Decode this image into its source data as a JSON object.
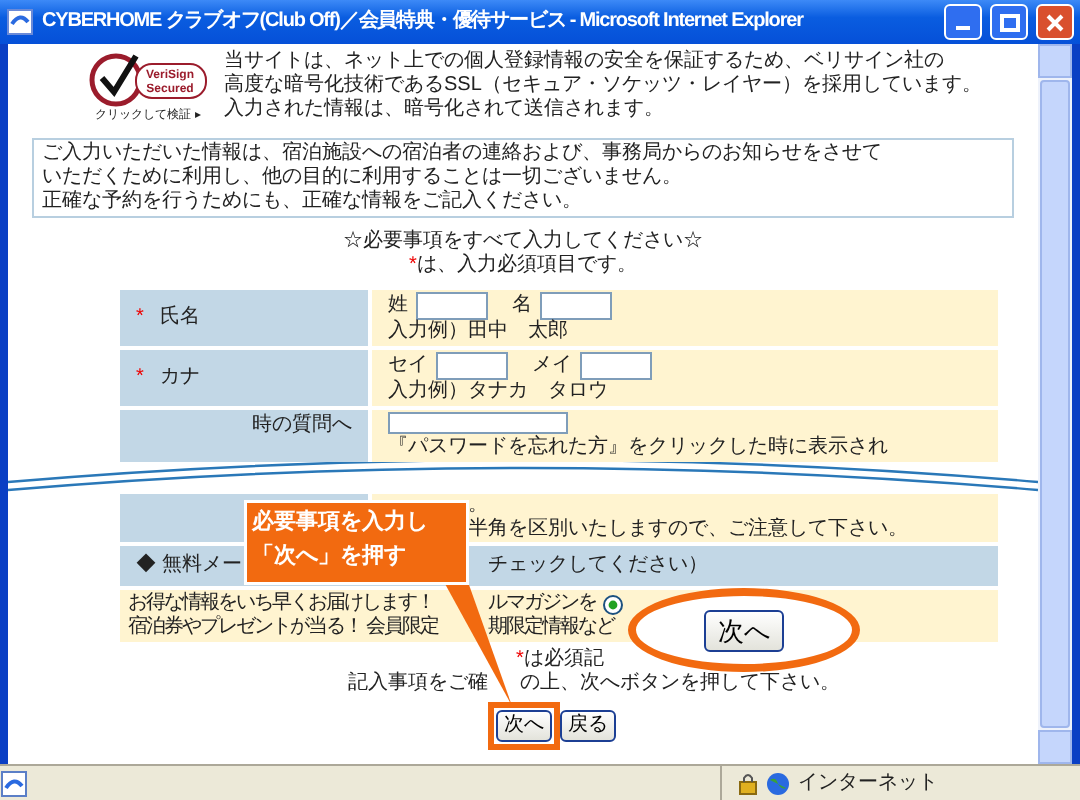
{
  "window": {
    "title": "CYBERHOME クラブオフ(Club Off)／会員特典・優待サービス - Microsoft Internet Explorer"
  },
  "ssl": {
    "badge_lines": [
      "VeriSign",
      "Secured"
    ],
    "badge_caption": "クリックして検証 ▸",
    "text_lines": [
      "当サイトは、ネット上での個人登録情報の安全を保証するため、ベリサイン社の",
      "高度な暗号化技術であるSSL（セキュア・ソケッツ・レイヤー）を採用しています。",
      "入力された情報は、暗号化されて送信されます。"
    ]
  },
  "notice": {
    "lines": [
      "ご入力いただいた情報は、宿泊施設への宿泊者の連絡および、事務局からのお知らせをさせて",
      "いただくために利用し、他の目的に利用することは一切ございません。",
      "正確な予約を行うためにも、正確な情報をご記入ください。"
    ]
  },
  "heading": {
    "title": "☆必要事項をすべて入力してください☆",
    "required_mark": "*",
    "required_note": "は、入力必須項目です。"
  },
  "form_rows": [
    {
      "kind": "name",
      "required_mark": "*",
      "label": "氏名",
      "inputs": [
        {
          "label": "姓"
        },
        {
          "label": "名"
        }
      ],
      "hint": "入力例）田中　太郎"
    },
    {
      "kind": "name",
      "required_mark": "*",
      "label": "カナ",
      "inputs": [
        {
          "label": "セイ"
        },
        {
          "label": "メイ"
        }
      ],
      "hint": "入力例）タナカ　タロウ"
    },
    {
      "kind": "partial",
      "label": "時の質問へ",
      "lines": [
        "『パスワードを忘れた方』をクリックした時に表示され"
      ]
    }
  ],
  "form_rows_after_tear": [
    {
      "kind": "fragment",
      "lines": [
        "。",
        "半角を区別いたしますので、ご注意して下さい。"
      ]
    },
    {
      "kind": "section",
      "label": "◆ 無料メー",
      "note": "チェックしてください）"
    },
    {
      "kind": "mail",
      "line1": [
        "お得な情報をいち早くお届けします！",
        "ルマガジンを"
      ],
      "radio_selected": true,
      "line2": [
        "宿泊券やプレゼントが当る！ 会員限定",
        "期限定情報など"
      ]
    }
  ],
  "footer": {
    "required_mark": "*",
    "required_note": "は必須記",
    "instruction_parts": [
      "記入事項をご確",
      "の上、次へボタンを押して下さい。"
    ],
    "buttons": [
      {
        "label": "次へ",
        "highlighted": true
      },
      {
        "label": "戻る",
        "highlighted": false
      }
    ]
  },
  "callout": {
    "lines": [
      "必要事項を入力し",
      "「次へ」を押す"
    ]
  },
  "magnifier": {
    "button": "次へ"
  },
  "status_bar": {
    "zone": "インターネット"
  }
}
